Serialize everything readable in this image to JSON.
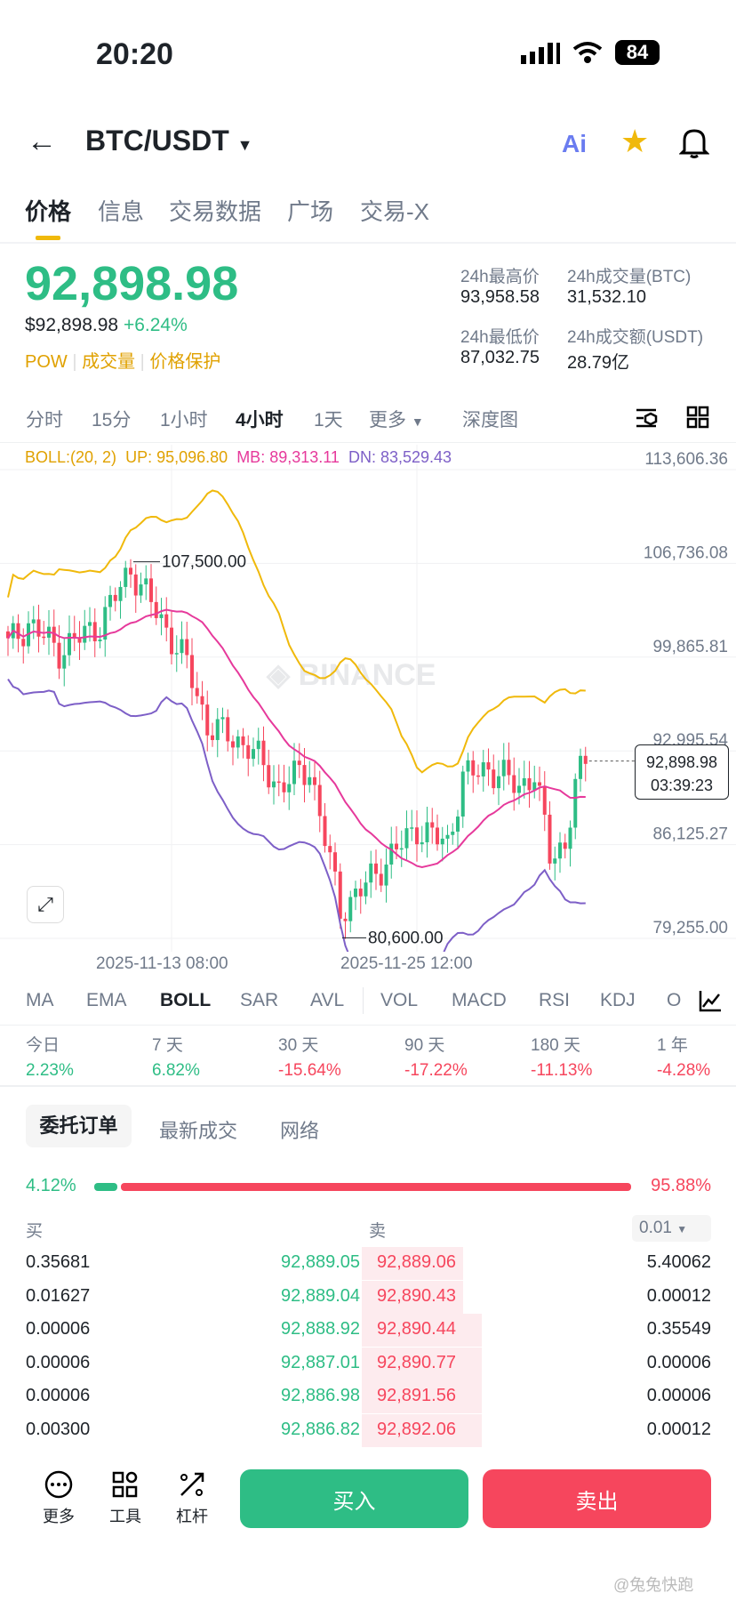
{
  "status": {
    "time": "20:20",
    "battery": "84"
  },
  "header": {
    "pair": "BTC/USDT",
    "ai_label": "Ai"
  },
  "tabs": [
    "价格",
    "信息",
    "交易数据",
    "广场",
    "交易-X"
  ],
  "price": {
    "last": "92,898.98",
    "usd": "$92,898.98",
    "change": "+6.24%",
    "tags": [
      "POW",
      "成交量",
      "价格保护"
    ]
  },
  "stats": {
    "high_label": "24h最高价",
    "high": "93,958.58",
    "vol_btc_label": "24h成交量(BTC)",
    "vol_btc": "31,532.10",
    "low_label": "24h最低价",
    "low": "87,032.75",
    "vol_usdt_label": "24h成交额(USDT)",
    "vol_usdt": "28.79亿"
  },
  "intervals": [
    "分时",
    "15分",
    "1小时",
    "4小时",
    "1天",
    "更多",
    "深度图"
  ],
  "boll": {
    "label": "BOLL:(20, 2)",
    "up": "UP: 95,096.80",
    "mb": "MB: 89,313.11",
    "dn": "DN: 83,529.43"
  },
  "chart": {
    "axis": [
      "113,606.36",
      "106,736.08",
      "99,865.81",
      "92,995.54",
      "86,125.27",
      "79,255.00"
    ],
    "axis_values": [
      113606.36,
      106736.08,
      99865.81,
      92995.54,
      86125.27,
      79255.0
    ],
    "high_mark": "107,500.00",
    "low_mark": "80,600.00",
    "current": "92,898.98",
    "countdown": "03:39:23",
    "dates": [
      "2025-11-13 08:00",
      "2025-11-25 12:00"
    ],
    "watermark": "BINANCE",
    "anchors": [
      [
        0,
        101400
      ],
      [
        4,
        103000
      ],
      [
        10,
        101000
      ],
      [
        18,
        102900
      ],
      [
        24,
        107000
      ],
      [
        30,
        103200
      ],
      [
        35,
        100000
      ],
      [
        39,
        95500
      ],
      [
        47,
        94000
      ],
      [
        53,
        91000
      ],
      [
        59,
        92400
      ],
      [
        65,
        82000
      ],
      [
        69,
        83400
      ],
      [
        74,
        85600
      ],
      [
        80,
        88000
      ],
      [
        86,
        86800
      ],
      [
        89,
        91700
      ],
      [
        94,
        92400
      ],
      [
        100,
        91000
      ],
      [
        103,
        92000
      ],
      [
        106,
        86000
      ],
      [
        109,
        86800
      ],
      [
        111,
        91000
      ],
      [
        113,
        92900
      ]
    ],
    "colors": {
      "up": "#2ebd85",
      "down": "#f6465d",
      "boll_up": "#f0b90b",
      "boll_mb": "#e6399b",
      "boll_dn": "#7d5fc7"
    }
  },
  "indicators": [
    "MA",
    "EMA",
    "BOLL",
    "SAR",
    "AVL",
    "VOL",
    "MACD",
    "RSI",
    "KDJ",
    "O"
  ],
  "periods": [
    {
      "label": "今日",
      "value": "2.23%",
      "up": true
    },
    {
      "label": "7 天",
      "value": "6.82%",
      "up": true
    },
    {
      "label": "30 天",
      "value": "-15.64%",
      "up": false
    },
    {
      "label": "90 天",
      "value": "-17.22%",
      "up": false
    },
    {
      "label": "180 天",
      "value": "-11.13%",
      "up": false
    },
    {
      "label": "1 年",
      "value": "-4.28%",
      "up": false
    }
  ],
  "book_tabs": [
    "委托订单",
    "最新成交",
    "网络"
  ],
  "ratio": {
    "buy": "4.12%",
    "sell": "95.88%",
    "buy_frac": 0.0412
  },
  "book": {
    "buy_label": "买",
    "sell_label": "卖",
    "precision": "0.01",
    "rows": [
      {
        "bq": "0.35681",
        "bp": "92,889.05",
        "ap": "92,889.06",
        "aq": "5.40062"
      },
      {
        "bq": "0.01627",
        "bp": "92,889.04",
        "ap": "92,890.43",
        "aq": "0.00012"
      },
      {
        "bq": "0.00006",
        "bp": "92,888.92",
        "ap": "92,890.44",
        "aq": "0.35549"
      },
      {
        "bq": "0.00006",
        "bp": "92,887.01",
        "ap": "92,890.77",
        "aq": "0.00006"
      },
      {
        "bq": "0.00006",
        "bp": "92,886.98",
        "ap": "92,891.56",
        "aq": "0.00006"
      },
      {
        "bq": "0.00300",
        "bp": "92,886.82",
        "ap": "92,892.06",
        "aq": "0.00012"
      }
    ]
  },
  "bottom": {
    "more": "更多",
    "tools": "工具",
    "leverage": "杠杆",
    "buy": "买入",
    "sell": "卖出"
  },
  "footer_watermark": "@兔兔快跑"
}
